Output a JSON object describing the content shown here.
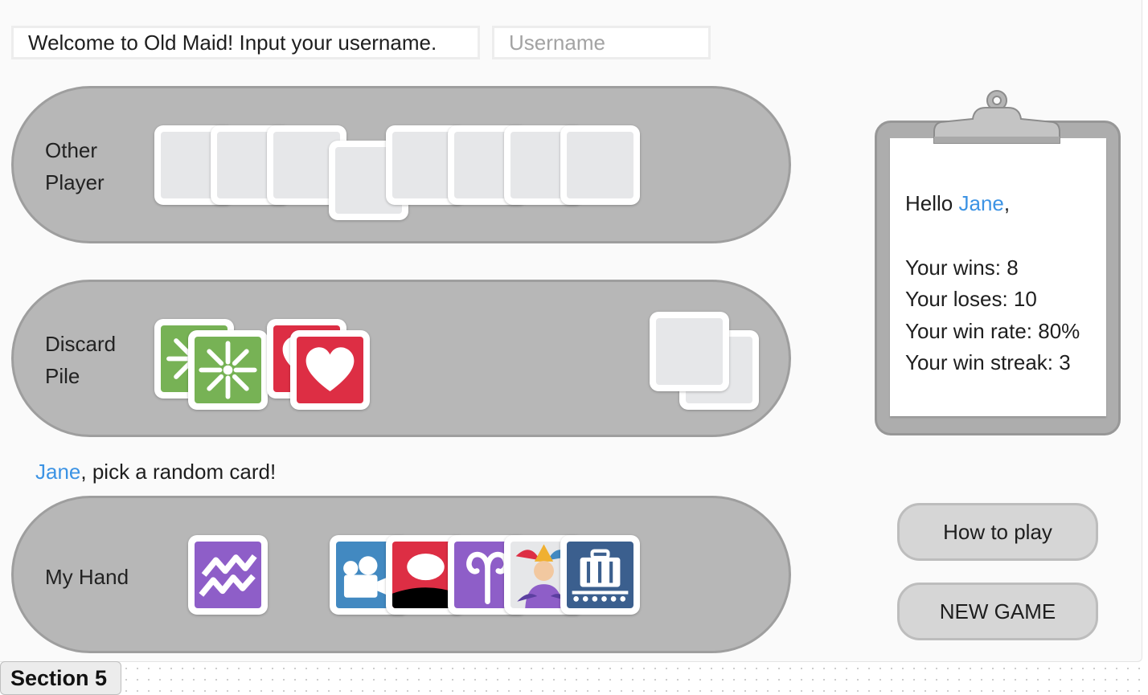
{
  "header": {
    "welcome_text": "Welcome to Old Maid! Input your username.",
    "username_placeholder": "Username"
  },
  "other_player": {
    "label_line1": "Other",
    "label_line2": "Player",
    "card_count": 8
  },
  "discard_pile": {
    "label_line1": "Discard",
    "label_line2": "Pile",
    "cards": [
      {
        "icon": "asterisk-card-icon",
        "color": "#77b255"
      },
      {
        "icon": "asterisk-card-icon",
        "color": "#77b255"
      },
      {
        "icon": "heart-card-icon",
        "color": "#dd2e44"
      },
      {
        "icon": "heart-card-icon",
        "color": "#dd2e44"
      }
    ],
    "draw_stack_count": 2
  },
  "turn_prompt": {
    "player_name": "Jane",
    "message": ", pick a random card!"
  },
  "my_hand": {
    "label": "My Hand",
    "cards": [
      {
        "icon": "aquarius-card-icon",
        "color": "#8e5ec8"
      },
      {
        "icon": "movie-camera-card-icon",
        "color": "#4289c1"
      },
      {
        "icon": "speech-bubble-card-icon",
        "color": "#dd2e44"
      },
      {
        "icon": "aries-card-icon",
        "color": "#8e5ec8"
      },
      {
        "icon": "jester-card-icon",
        "color": "#f0c030"
      },
      {
        "icon": "baggage-claim-card-icon",
        "color": "#3b5f8e"
      }
    ]
  },
  "stats_panel": {
    "greeting_prefix": "Hello ",
    "player_name": "Jane",
    "greeting_suffix": ",",
    "wins": "Your wins: 8",
    "loses": "Your loses: 10",
    "win_rate": "Your win rate: 80%",
    "win_streak": "Your win streak: 3"
  },
  "buttons": {
    "how_to_play": "How to play",
    "new_game": "NEW GAME"
  },
  "section_tab": "Section 5",
  "colors": {
    "accent_name": "#3c93e4",
    "zone_fill": "#b7b7b7",
    "card_back": "#e6e7e9"
  }
}
